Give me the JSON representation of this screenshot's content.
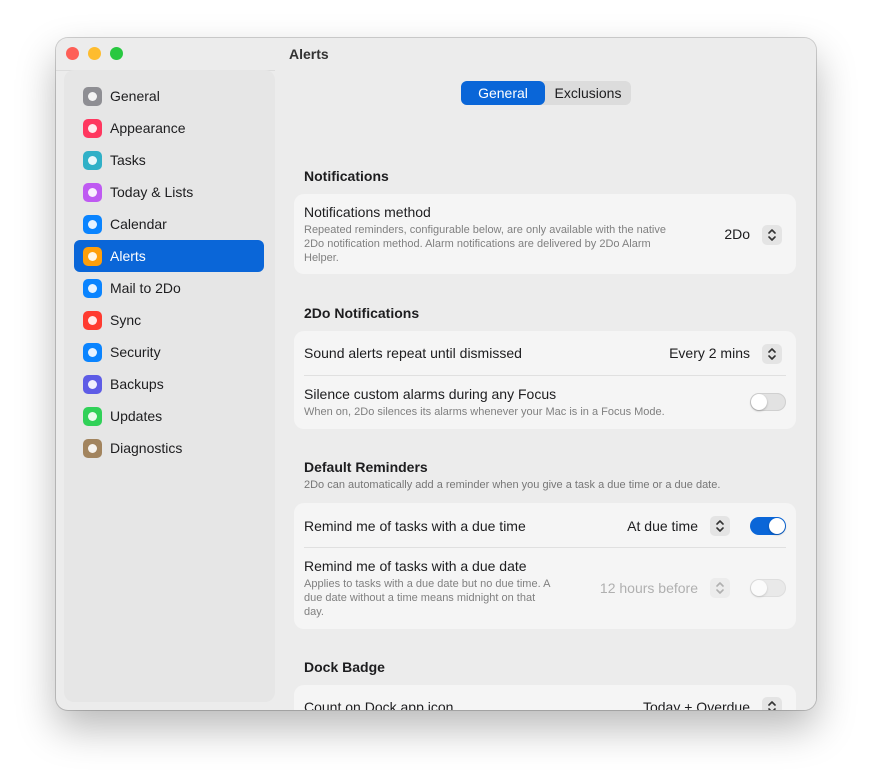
{
  "window": {
    "title": "Alerts"
  },
  "sidebar": {
    "items": [
      {
        "label": "General",
        "icon": "gear-icon",
        "color": "#8e8e93",
        "selected": false
      },
      {
        "label": "Appearance",
        "icon": "paintbrush-icon",
        "color": "#ff375f",
        "selected": false
      },
      {
        "label": "Tasks",
        "icon": "checkmark-icon",
        "color": "#30b0c7",
        "selected": false
      },
      {
        "label": "Today & Lists",
        "icon": "list-icon",
        "color": "#bf5af2",
        "selected": false
      },
      {
        "label": "Calendar",
        "icon": "calendar-icon",
        "color": "#0a84ff",
        "selected": false
      },
      {
        "label": "Alerts",
        "icon": "bell-icon",
        "color": "#ff9f0a",
        "selected": true
      },
      {
        "label": "Mail to 2Do",
        "icon": "envelope-icon",
        "color": "#0a84ff",
        "selected": false
      },
      {
        "label": "Sync",
        "icon": "sync-icon",
        "color": "#ff3b30",
        "selected": false
      },
      {
        "label": "Security",
        "icon": "lock-icon",
        "color": "#0a84ff",
        "selected": false
      },
      {
        "label": "Backups",
        "icon": "clock-icon",
        "color": "#5e5ce6",
        "selected": false
      },
      {
        "label": "Updates",
        "icon": "refresh-icon",
        "color": "#30d158",
        "selected": false
      },
      {
        "label": "Diagnostics",
        "icon": "stethoscope-icon",
        "color": "#a2845e",
        "selected": false
      }
    ]
  },
  "tabs": {
    "general": "General",
    "exclusions": "Exclusions"
  },
  "sections": {
    "notifications": {
      "title": "Notifications",
      "method_title": "Notifications method",
      "method_desc_1": "Repeated reminders, configurable below, are only available with the native",
      "method_desc_2": "2Do notification method. Alarm notifications are delivered by 2Do Alarm",
      "method_desc_3": "Helper.",
      "method_value": "2Do"
    },
    "twodo": {
      "title": "2Do Notifications",
      "repeat_title": "Sound alerts repeat until dismissed",
      "repeat_value": "Every 2 mins",
      "silence_title": "Silence custom alarms during any Focus",
      "silence_desc": "When on, 2Do silences its alarms whenever your Mac is in a Focus Mode.",
      "silence_on": false
    },
    "default_reminders": {
      "title": "Default Reminders",
      "desc": "2Do can automatically add a reminder when you give a task a due time or a due date.",
      "due_time_title": "Remind me of tasks with a due time",
      "due_time_value": "At due time",
      "due_time_on": true,
      "due_date_title": "Remind me of tasks with a due date",
      "due_date_desc_1": "Applies to tasks with a due date but no due time. A",
      "due_date_desc_2": "due date without a time means midnight on that",
      "due_date_desc_3": "day.",
      "due_date_value": "12 hours before",
      "due_date_on": false
    },
    "dock": {
      "title": "Dock Badge",
      "count_title": "Count on Dock app icon",
      "count_value": "Today + Overdue"
    }
  }
}
